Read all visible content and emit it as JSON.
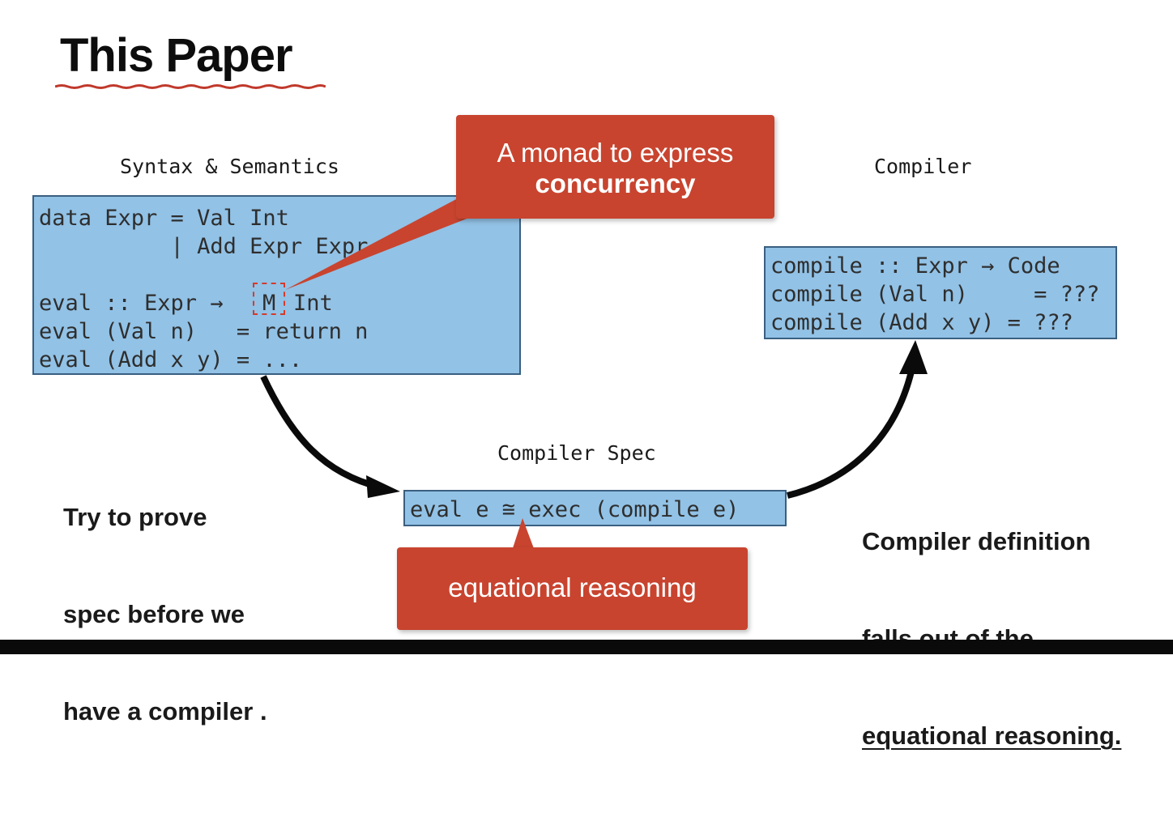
{
  "title": "This Paper",
  "colors": {
    "code_box_fill": "#92c2e6",
    "callout_fill": "#c8442f",
    "highlight_border": "#d63a2a",
    "arrow": "#0a0a0a"
  },
  "syntax_section": {
    "heading": "Syntax & Semantics",
    "code": [
      "data Expr = Val Int",
      "          | Add Expr Expr",
      "",
      "eval :: Expr → M Int",
      "eval (Val n)   = return n",
      "eval (Add x y) = ..."
    ],
    "code_parts": {
      "line1": "data Expr = Val Int",
      "line2": "          | Add Expr Expr",
      "line4_prefix": "eval :: Expr →",
      "line4_m": "M",
      "line4_suffix": "Int",
      "line5": "eval (Val n)   = return n",
      "line6": "eval (Add x y) = ..."
    }
  },
  "monad_callout": {
    "line1": "A monad to express",
    "line2": "concurrency"
  },
  "compiler_section": {
    "heading": "Compiler",
    "code": [
      "compile :: Expr → Code",
      "compile (Val n)     = ???",
      "compile (Add x y) = ???"
    ]
  },
  "spec_section": {
    "heading": "Compiler Spec",
    "code": "eval e ≅ exec (compile e)"
  },
  "equational_callout": "equational reasoning",
  "left_note": [
    "Try to prove",
    "spec before we",
    "have a compiler ."
  ],
  "right_note": [
    "Compiler definition",
    "falls out of the",
    "equational reasoning."
  ]
}
